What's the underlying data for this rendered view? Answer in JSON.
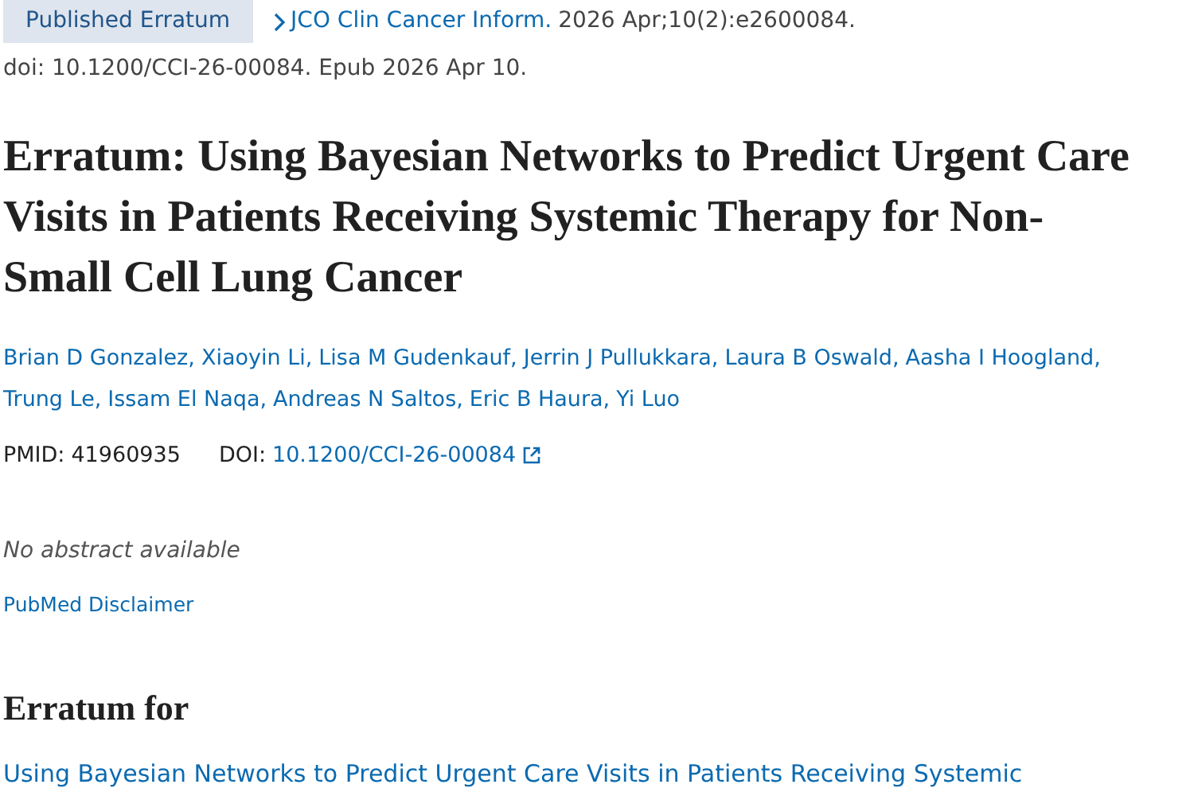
{
  "badge": "Published Erratum",
  "journal": {
    "name": "JCO Clin Cancer Inform.",
    "citation": "2026 Apr;10(2):e2600084."
  },
  "doi_line": "doi: 10.1200/CCI-26-00084. Epub 2026 Apr 10.",
  "title": "Erratum: Using Bayesian Networks to Predict Urgent Care Visits in Patients Receiving Systemic Therapy for Non-Small Cell Lung Cancer",
  "authors": [
    "Brian D Gonzalez,",
    "Xiaoyin Li,",
    "Lisa M Gudenkauf,",
    "Jerrin J Pullukkara,",
    "Laura B Oswald,",
    "Aasha I Hoogland,",
    "Trung Le,",
    "Issam El Naqa,",
    "Andreas N Saltos,",
    "Eric B Haura,",
    "Yi Luo"
  ],
  "identifiers": {
    "pmid_label": "PMID:",
    "pmid": "41960935",
    "doi_label": "DOI:",
    "doi": "10.1200/CCI-26-00084"
  },
  "abstract_note": "No abstract available",
  "disclaimer_link": "PubMed Disclaimer",
  "erratum_for": {
    "heading": "Erratum for",
    "link": "Using Bayesian Networks to Predict Urgent Care Visits in Patients Receiving Systemic"
  }
}
